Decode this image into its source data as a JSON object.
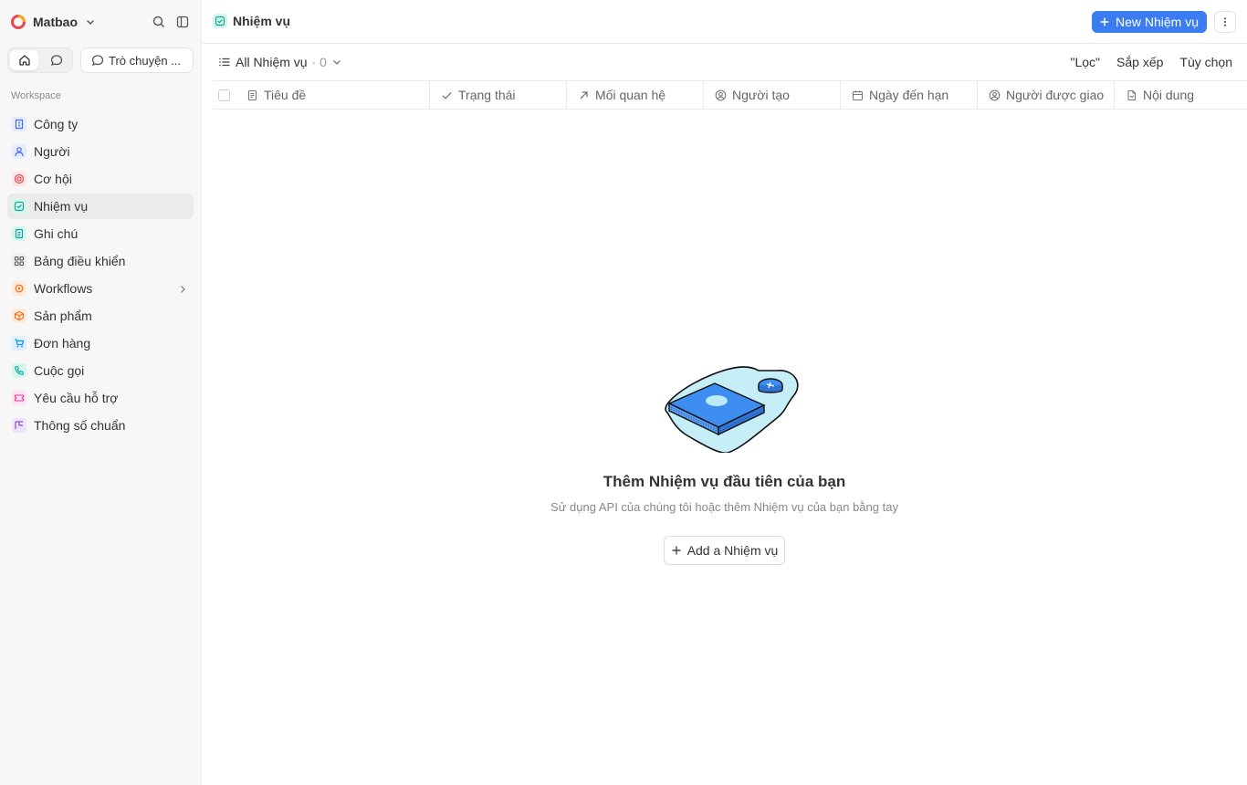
{
  "workspace": {
    "name": "Matbao"
  },
  "sidebar": {
    "chat_label": "Trò chuyện ...",
    "section_label": "Workspace",
    "items": [
      {
        "label": "Công ty",
        "icon": "building-icon",
        "color": "#4a6cf7"
      },
      {
        "label": "Người",
        "icon": "user-icon",
        "color": "#4a6cf7"
      },
      {
        "label": "Cơ hội",
        "icon": "target-icon",
        "color": "#e5484d"
      },
      {
        "label": "Nhiệm vụ",
        "icon": "checkbox-icon",
        "color": "#12a594"
      },
      {
        "label": "Ghi chú",
        "icon": "note-icon",
        "color": "#12a594"
      },
      {
        "label": "Bảng điều khiển",
        "icon": "dashboard-icon",
        "color": "#666666"
      },
      {
        "label": "Workflows",
        "icon": "workflow-icon",
        "color": "#f76b15"
      },
      {
        "label": "Sản phẩm",
        "icon": "box-icon",
        "color": "#f76b15"
      },
      {
        "label": "Đơn hàng",
        "icon": "cart-icon",
        "color": "#0090ff"
      },
      {
        "label": "Cuộc gọi",
        "icon": "phone-icon",
        "color": "#12a594"
      },
      {
        "label": "Yêu cầu hỗ trợ",
        "icon": "ticket-icon",
        "color": "#d6409f"
      },
      {
        "label": "Thông số chuẩn",
        "icon": "spec-icon",
        "color": "#8e4ec6"
      }
    ]
  },
  "header": {
    "title": "Nhiệm vụ",
    "new_button": "New Nhiệm vụ"
  },
  "view": {
    "name": "All Nhiệm vụ",
    "count": "· 0",
    "filter": "\"Lọc\"",
    "sort": "Sắp xếp",
    "options": "Tùy chọn"
  },
  "table": {
    "columns": [
      {
        "label": "Tiêu đề",
        "icon": "text-icon"
      },
      {
        "label": "Trạng thái",
        "icon": "check-icon"
      },
      {
        "label": "Mối quan hệ",
        "icon": "arrow-up-right-icon"
      },
      {
        "label": "Người tạo",
        "icon": "user-circle-icon"
      },
      {
        "label": "Ngày đến hạn",
        "icon": "calendar-icon"
      },
      {
        "label": "Người được giao",
        "icon": "user-circle-icon"
      },
      {
        "label": "Nội dung",
        "icon": "file-icon"
      }
    ]
  },
  "empty_state": {
    "title": "Thêm Nhiệm vụ đầu tiên của bạn",
    "subtitle": "Sử dụng API của chúng tôi hoặc thêm Nhiệm vụ của bạn bằng tay",
    "button": "Add a Nhiệm vụ"
  },
  "colors": {
    "accent": "#3b7cf0",
    "task_green": "#12a594"
  }
}
